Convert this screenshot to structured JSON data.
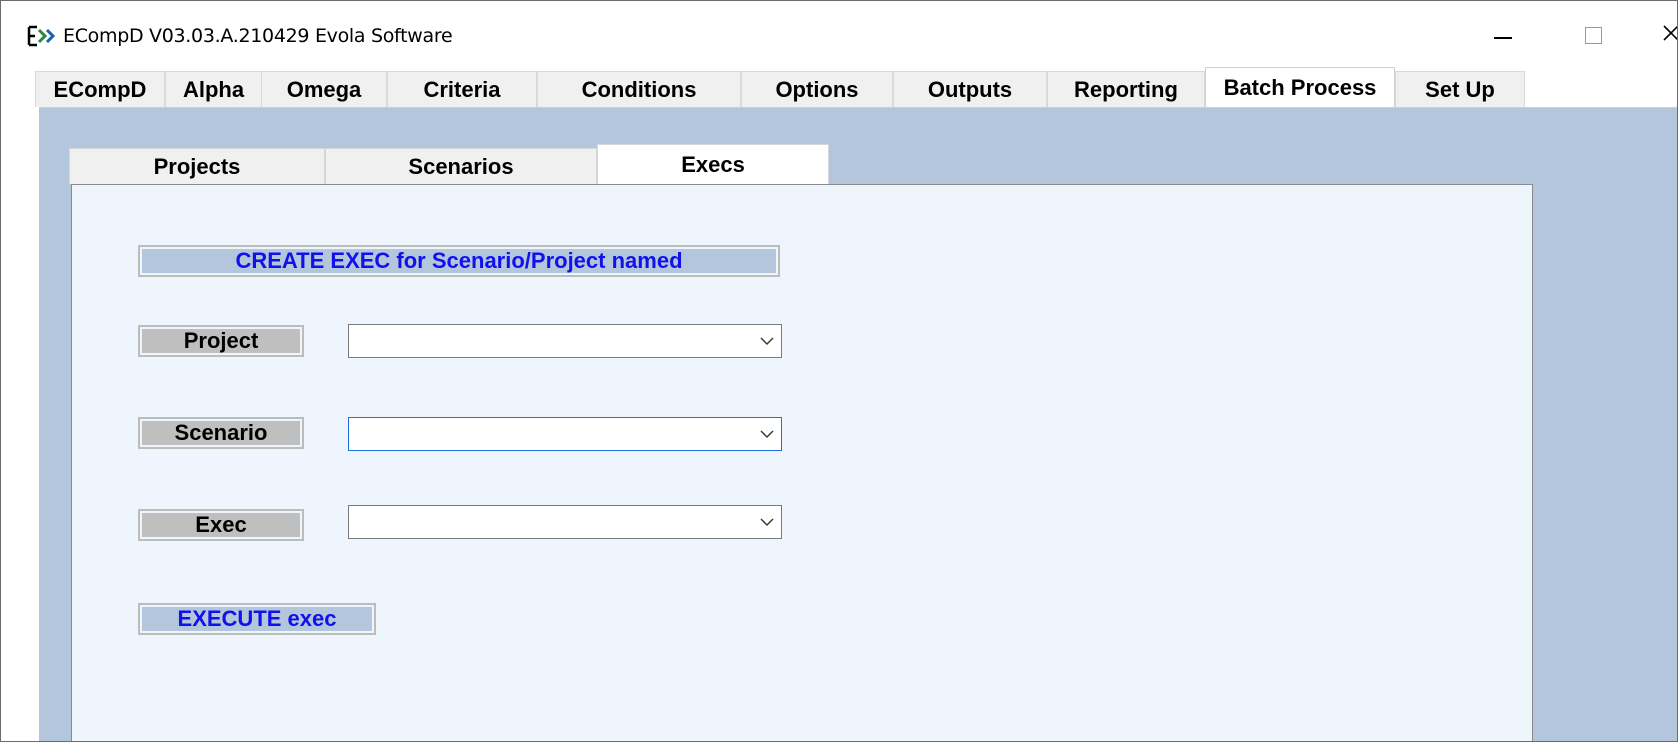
{
  "window": {
    "title": "ECompD  V03.03.A.210429  Evola Software",
    "icon": "ecompd-logo-icon"
  },
  "main_tabs": [
    {
      "label": "ECompD"
    },
    {
      "label": "Alpha"
    },
    {
      "label": "Omega"
    },
    {
      "label": "Criteria"
    },
    {
      "label": "Conditions"
    },
    {
      "label": "Options"
    },
    {
      "label": "Outputs"
    },
    {
      "label": "Reporting"
    },
    {
      "label": "Batch Process",
      "active": true
    },
    {
      "label": "Set Up"
    }
  ],
  "inner_tabs": [
    {
      "label": "Projects"
    },
    {
      "label": "Scenarios"
    },
    {
      "label": "Execs",
      "active": true
    }
  ],
  "execs_panel": {
    "header": "CREATE EXEC for Scenario/Project named",
    "project_label": "Project",
    "project_value": "",
    "scenario_label": "Scenario",
    "scenario_value": "",
    "exec_label": "Exec",
    "exec_value": "",
    "execute_label": "EXECUTE exec"
  },
  "colors": {
    "workspace": "#b4c6dc",
    "panel": "#eef5fd",
    "accent_text": "#1111ee",
    "focus_border": "#1f6fdc"
  }
}
